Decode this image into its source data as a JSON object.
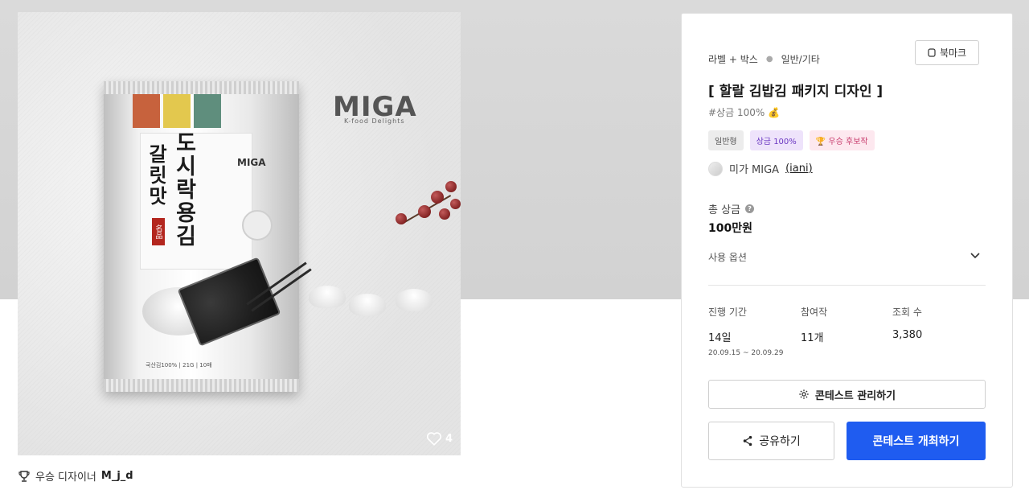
{
  "artwork": {
    "likes_count": "4",
    "brand_logo": "MIGA",
    "brand_logo_sub": "K-food Delights",
    "package_title_1": "도시락용김",
    "package_title_2": "갈릿맛",
    "package_seal": "名品",
    "package_small_logo": "MIGA",
    "package_info": "국산김100% | 21G | 10매"
  },
  "winner": {
    "label": "우승 디자이너",
    "name": "M_j_d"
  },
  "contest": {
    "breadcrumb": [
      "라벨 + 박스",
      "일반/기타"
    ],
    "bookmark_label": "북마크",
    "title": "[ 할랄 김밥김 패키지 디자인 ]",
    "tagline": "#상금 100% 💰",
    "chips": [
      "일반형",
      "상금 100%",
      "🏆 우승 후보작"
    ],
    "host_name": "미가 MIGA",
    "host_id": "(iani)",
    "prize_label": "총 상금",
    "prize_help_icon": "?",
    "prize_value": "100만원",
    "usage_label": "사용 옵션",
    "stats": [
      {
        "label": "진행 기간",
        "value": "14일",
        "sub": "20.09.15 ~ 20.09.29"
      },
      {
        "label": "참여작",
        "value": "11개"
      },
      {
        "label": "조회 수",
        "value": "3,380"
      }
    ],
    "manage_button": "콘테스트 관리하기",
    "share_button": "공유하기",
    "host_button": "콘테스트 개최하기"
  },
  "colors": {
    "primary": "#1f5cf0",
    "chip_purple": "#6b38c2",
    "chip_pink": "#c73a6b"
  }
}
